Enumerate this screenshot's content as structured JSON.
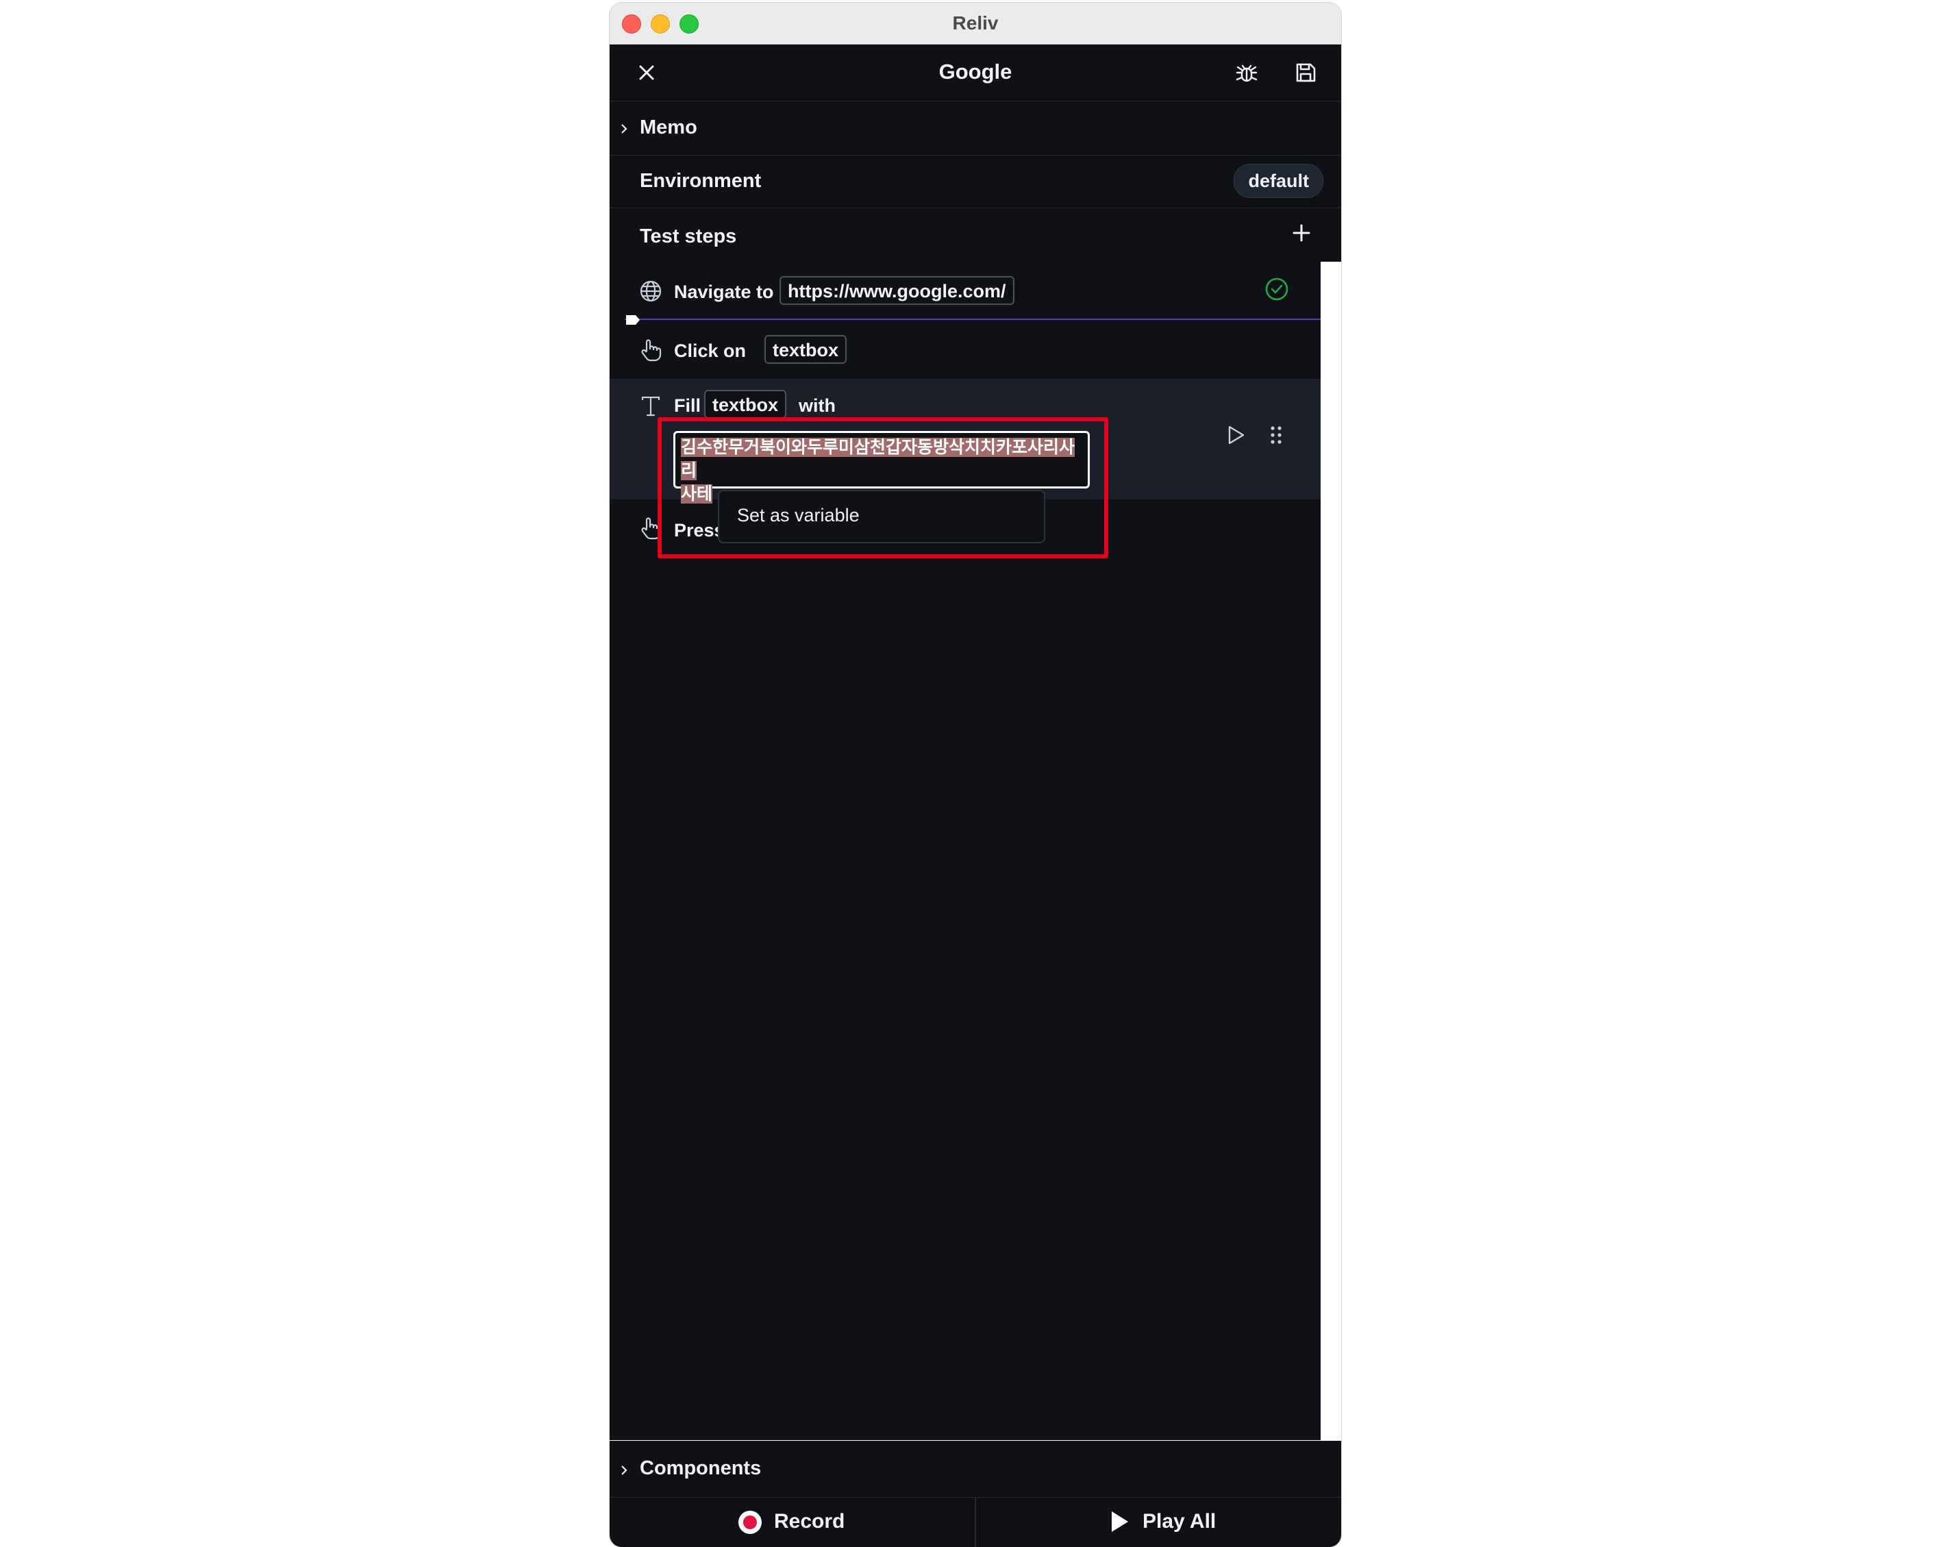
{
  "window": {
    "title": "Reliv"
  },
  "header": {
    "title": "Google"
  },
  "sections": {
    "memo": "Memo",
    "environment": {
      "label": "Environment",
      "value": "default"
    },
    "test_steps": "Test steps",
    "components": "Components"
  },
  "steps": [
    {
      "action": "Navigate to",
      "target": "https://www.google.com/",
      "status": "passed",
      "icon": "globe-icon"
    },
    {
      "action": "Click on",
      "target": "textbox",
      "icon": "pointer-hand-icon"
    },
    {
      "action": "Fill",
      "target": "textbox",
      "connector": "with",
      "value_line1": "김수한무거북이와두루미삼천갑자동방삭치치카포사리사리",
      "value_line2": "사테",
      "icon": "text-t-icon"
    },
    {
      "action": "Press",
      "icon": "pointer-hand-icon"
    }
  ],
  "context_menu": {
    "items": [
      "Set as variable"
    ]
  },
  "footer": {
    "record": "Record",
    "play_all": "Play All"
  },
  "colors": {
    "background": "#0f1117",
    "highlight": "#e3001b",
    "record": "#e3143f",
    "selection": "#a36a6c",
    "success": "#22a94a"
  }
}
